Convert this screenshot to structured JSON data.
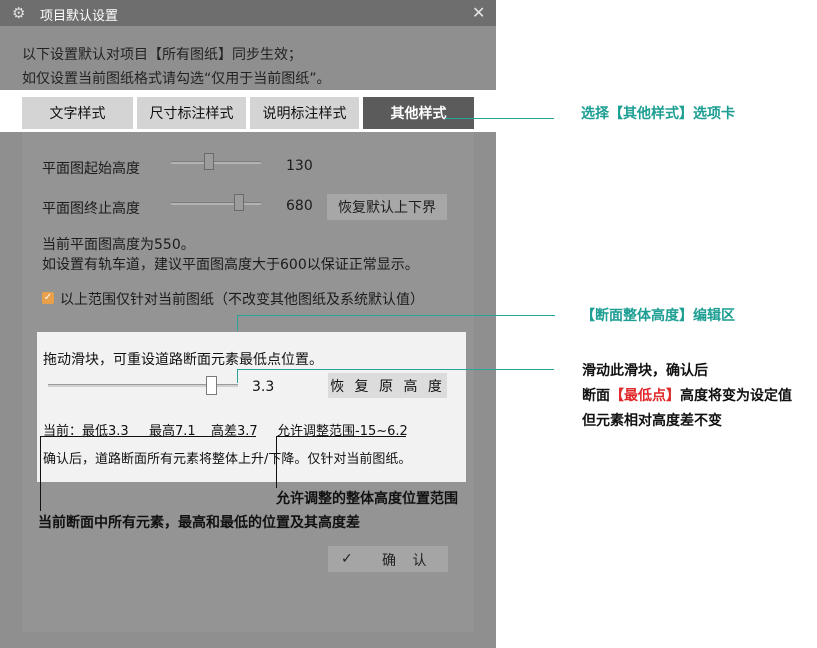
{
  "dialog": {
    "title": "项目默认设置",
    "intro_line1": "以下设置默认对项目【所有图纸】同步生效；",
    "intro_line2": "如仅设置当前图纸格式请勾选“仅用于当前图纸”。"
  },
  "tabs": [
    {
      "label": "文字样式",
      "active": false
    },
    {
      "label": "尺寸标注样式",
      "active": false
    },
    {
      "label": "说明标注样式",
      "active": false
    },
    {
      "label": "其他样式",
      "active": true
    }
  ],
  "plan": {
    "start_label": "平面图起始高度",
    "start_value": "130",
    "start_slider_fraction": 0.43,
    "end_label": "平面图终止高度",
    "end_value": "680",
    "end_slider_fraction": 0.76,
    "restore_bounds_label": "恢复默认上下界",
    "info1": "当前平面图高度为550。",
    "info2": "如设置有轨车道，建议平面图高度大于600以保证正常显示。",
    "checkbox_label": "以上范围仅针对当前图纸（不改变其他图纸及系统默认值）",
    "checkbox_checked": true
  },
  "section": {
    "instruction": "拖动滑块，可重设道路断面元素最低点位置。",
    "slider_value": "3.3",
    "restore_label": "恢 复 原 高 度",
    "current_min": "当前：最低3.3",
    "current_max": "最高7.1",
    "diff": "高差3.7",
    "range": "允许调整范围-15~6.2",
    "note": "确认后，道路断面所有元素将整体上升/下降。仅针对当前图纸。"
  },
  "ok_button": {
    "icon": "check-icon",
    "label": "确  认"
  },
  "annotations": {
    "select_tab": "选择【其他样式】选项卡",
    "edit_area": "【断面整体高度】编辑区",
    "slider_line1": "滑动此滑块，确认后",
    "slider_line2_a": "断面",
    "slider_line2_red": "【最低点】",
    "slider_line2_b": "高度将变为设定值",
    "slider_line3": "但元素相对高度差不变",
    "range_note": "允许调整的整体高度位置范围",
    "current_note": "当前断面中所有元素，最高和最低的位置及其高度差"
  },
  "colors": {
    "teal": "#1c9e93",
    "red": "#e0282a",
    "checkbox": "#e8a14a"
  }
}
